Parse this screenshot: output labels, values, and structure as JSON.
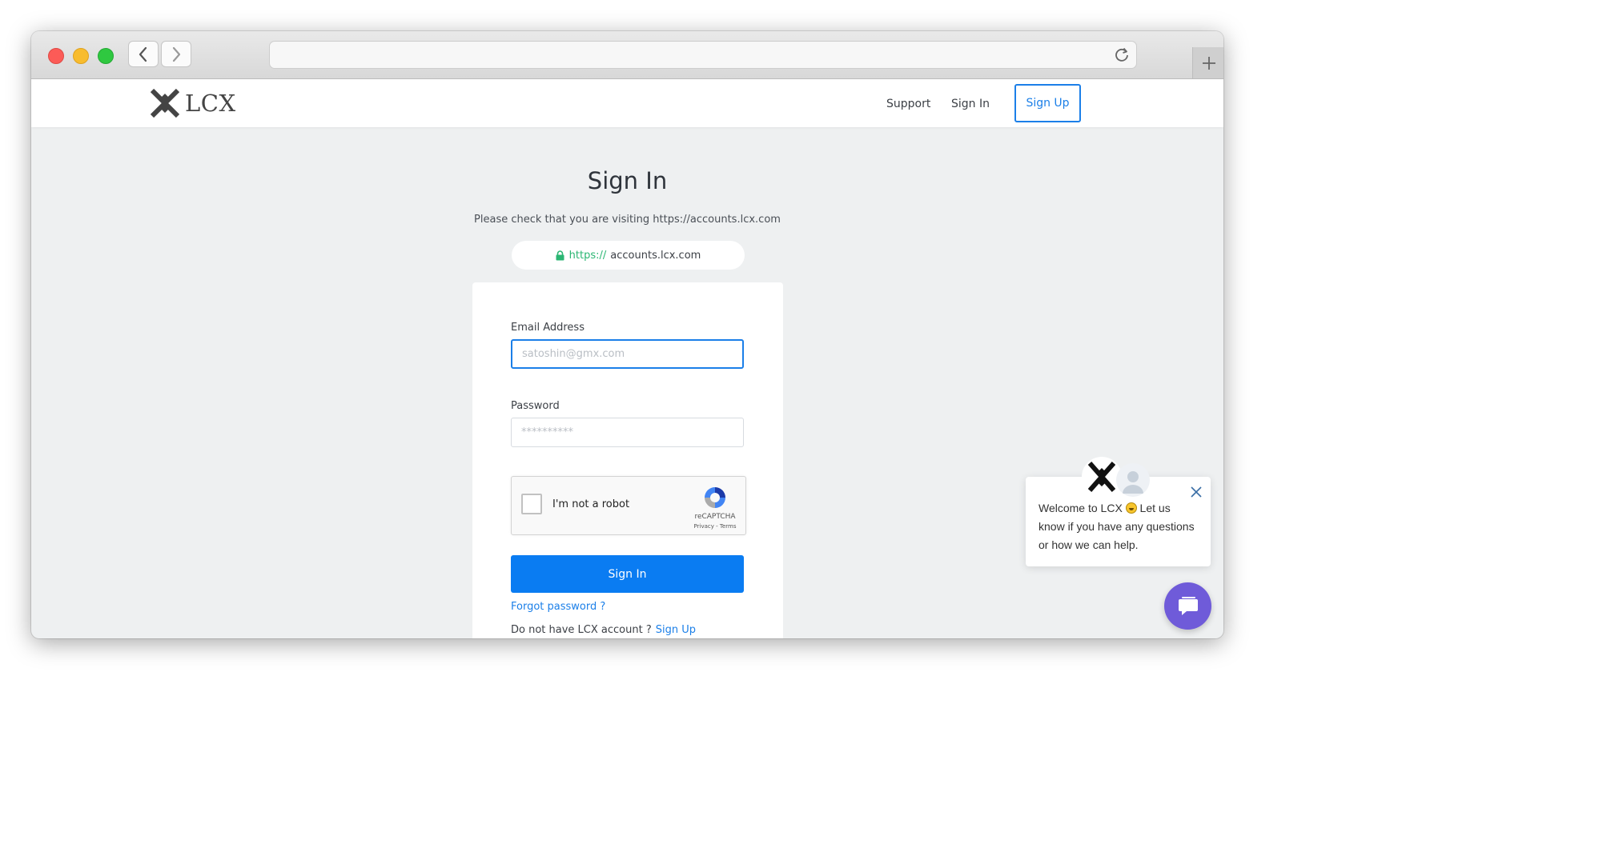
{
  "browser": {
    "url": "",
    "controls": [
      "close",
      "minimize",
      "zoom",
      "back",
      "forward",
      "reload",
      "new-tab"
    ]
  },
  "header": {
    "logo_text": "LCX",
    "nav": {
      "support": "Support",
      "sign_in": "Sign In",
      "sign_up": "Sign Up"
    }
  },
  "page": {
    "title": "Sign In",
    "notice": "Please check that you are visiting https://accounts.lcx.com",
    "url_pill": {
      "scheme": "https://",
      "domain": "accounts.lcx.com"
    }
  },
  "form": {
    "email_label": "Email Address",
    "email_placeholder": "satoshin@gmx.com",
    "email_value": "",
    "password_label": "Password",
    "password_placeholder": "**********",
    "password_value": "",
    "captcha": {
      "label": "I'm not a robot",
      "brand": "reCAPTCHA",
      "links": "Privacy - Terms",
      "checked": false
    },
    "submit_label": "Sign In",
    "forgot_label": "Forgot password ?",
    "no_account_text": "Do not have LCX account ?",
    "sign_up_link": "Sign Up"
  },
  "chat": {
    "message_part1": "Welcome to LCX",
    "message_part2": " Let us know if you have any questions or how we can help.",
    "emoji": "smiley"
  },
  "colors": {
    "accent": "#1b7fe8",
    "primary_button": "#0a7cf2",
    "secure_green": "#2bb673",
    "chat_launcher": "#6f5bd9",
    "page_bg": "#eef0f1"
  }
}
